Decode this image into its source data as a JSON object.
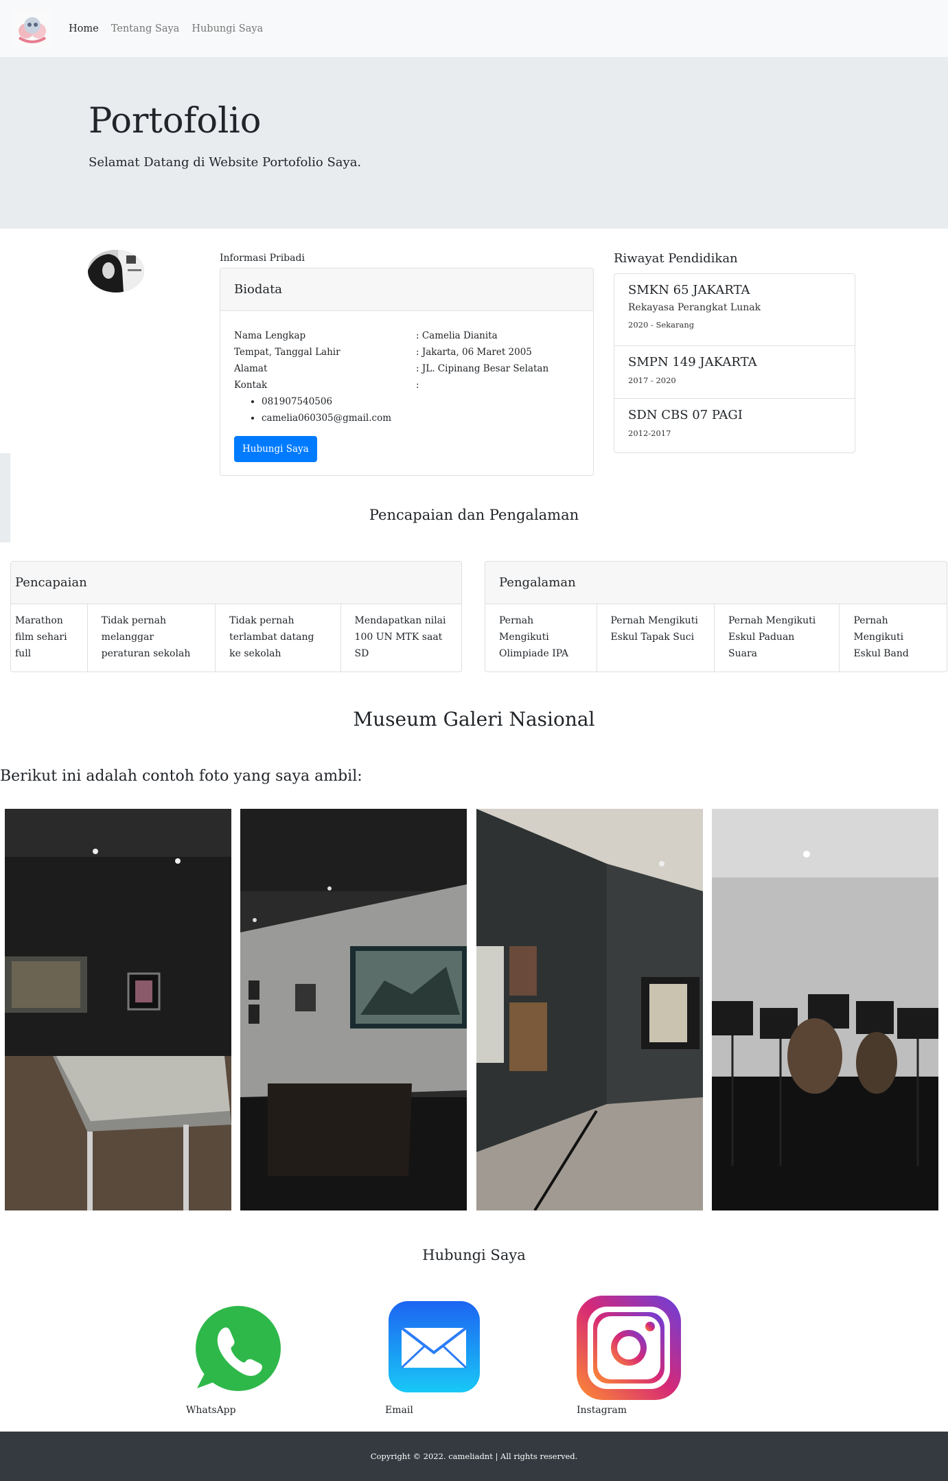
{
  "nav": {
    "links": [
      {
        "label": "Home",
        "active": true
      },
      {
        "label": "Tentang Saya",
        "active": false
      },
      {
        "label": "Hubungi Saya",
        "active": false
      }
    ]
  },
  "hero": {
    "title": "Portofolio",
    "subtitle": "Selamat Datang di Website Portofolio Saya."
  },
  "profile": {
    "section_label": "Informasi Pribadi",
    "card_title": "Biodata",
    "rows": [
      {
        "key": "Nama Lengkap",
        "value": ": Camelia Dianita"
      },
      {
        "key": "Tempat, Tanggal Lahir",
        "value": ": Jakarta, 06 Maret 2005"
      },
      {
        "key": "Alamat",
        "value": ": JL. Cipinang Besar Selatan"
      },
      {
        "key": "Kontak",
        "value": ":"
      }
    ],
    "contacts": [
      "081907540506",
      "camelia060305@gmail.com"
    ],
    "button_label": "Hubungi Saya"
  },
  "education": {
    "title": "Riwayat Pendidikan",
    "items": [
      {
        "school": "SMKN 65 JAKARTA",
        "major": "Rekayasa Perangkat Lunak",
        "years": "2020 - Sekarang"
      },
      {
        "school": "SMPN 149 JAKARTA",
        "major": "",
        "years": "2017 - 2020"
      },
      {
        "school": "SDN CBS 07 PAGI",
        "major": "",
        "years": "2012-2017"
      }
    ]
  },
  "achievements_section": {
    "title": "Pencapaian dan Pengalaman",
    "pencapaian": {
      "title": "Pencapaian",
      "items": [
        "Marathon film sehari full",
        "Tidak pernah melanggar peraturan sekolah",
        "Tidak pernah terlambat datang ke sekolah",
        "Mendapatkan nilai 100 UN MTK saat SD"
      ]
    },
    "pengalaman": {
      "title": "Pengalaman",
      "items": [
        "Pernah Mengikuti Olimpiade IPA",
        "Pernah Mengikuti Eskul Tapak Suci",
        "Pernah Mengikuti Eskul Paduan Suara",
        "Pernah Mengikuti Eskul Band"
      ]
    }
  },
  "gallery": {
    "title": "Museum Galeri Nasional",
    "intro": "Berikut ini adalah contoh foto yang saya ambil:"
  },
  "contact": {
    "title": "Hubungi Saya",
    "items": [
      {
        "label": "WhatsApp",
        "icon": "whatsapp-icon"
      },
      {
        "label": "Email",
        "icon": "email-icon"
      },
      {
        "label": "Instagram",
        "icon": "instagram-icon"
      }
    ]
  },
  "footer": {
    "text": "Copyright © 2022. cameliadnt | All rights reserved."
  },
  "colors": {
    "primary": "#007bff",
    "hero_bg": "#e9ecef",
    "footer_bg": "#343a40"
  }
}
